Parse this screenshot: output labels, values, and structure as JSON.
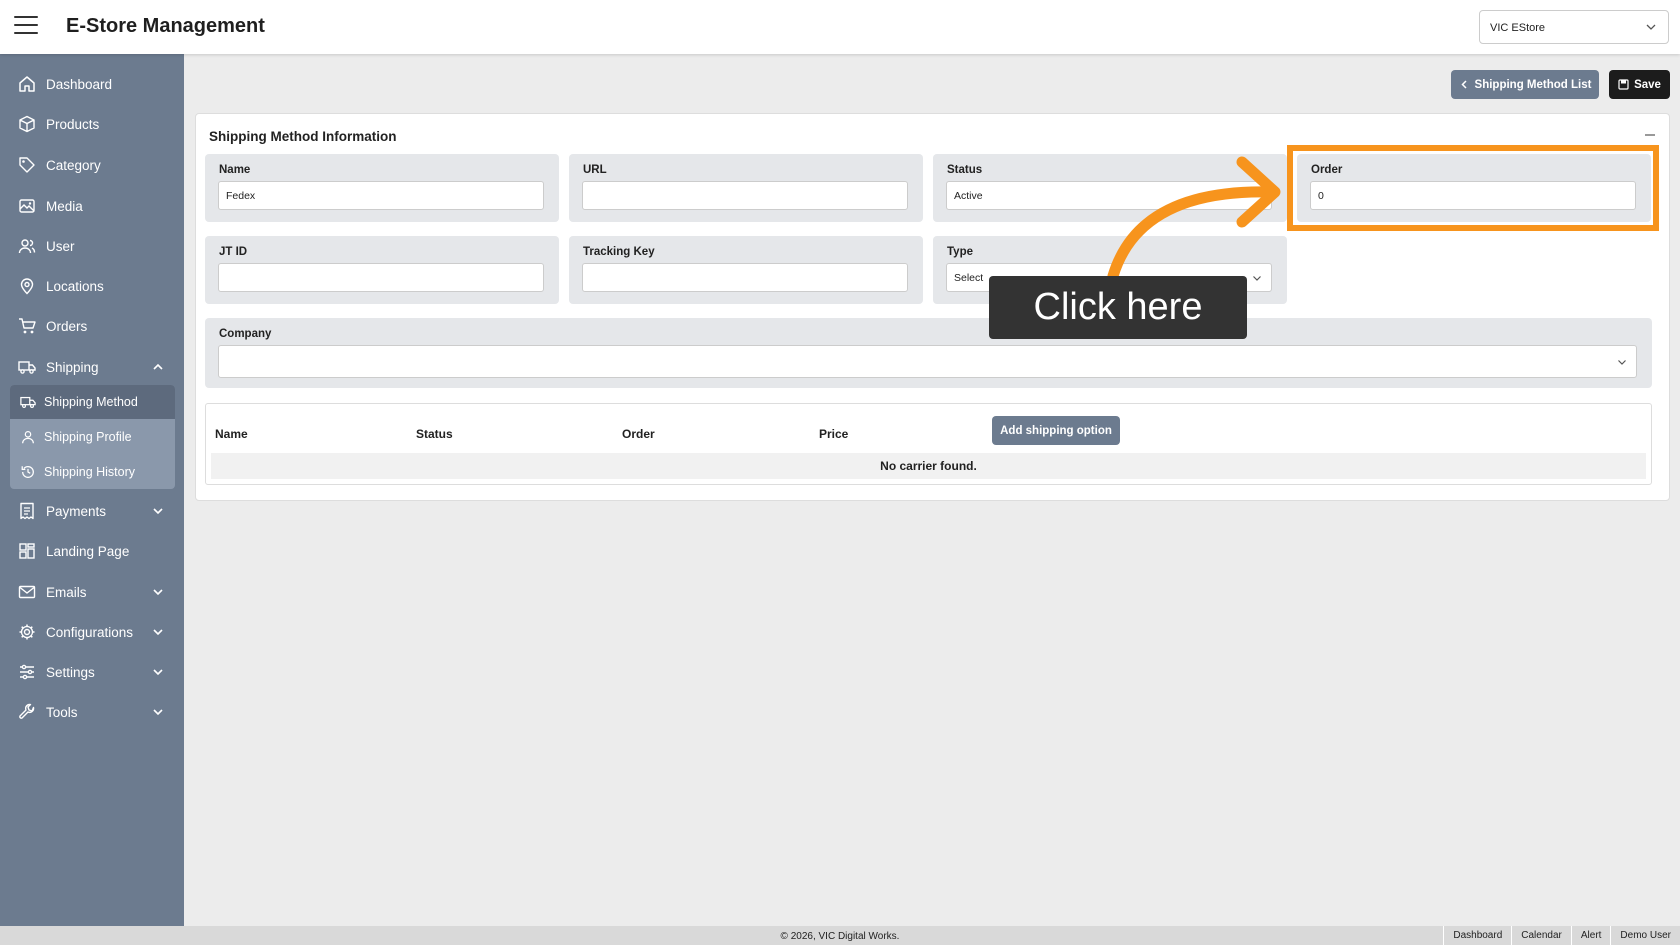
{
  "header": {
    "title": "E-Store Management",
    "store_selected": "VIC EStore"
  },
  "sidebar": {
    "items": [
      {
        "label": "Dashboard",
        "icon": "home-icon"
      },
      {
        "label": "Products",
        "icon": "box-icon"
      },
      {
        "label": "Category",
        "icon": "tag-icon"
      },
      {
        "label": "Media",
        "icon": "image-icon"
      },
      {
        "label": "User",
        "icon": "users-icon"
      },
      {
        "label": "Locations",
        "icon": "map-pin-icon"
      },
      {
        "label": "Orders",
        "icon": "cart-icon"
      },
      {
        "label": "Shipping",
        "icon": "truck-icon"
      },
      {
        "label": "Payments",
        "icon": "receipt-icon"
      },
      {
        "label": "Landing Page",
        "icon": "layout-icon"
      },
      {
        "label": "Emails",
        "icon": "mail-icon"
      },
      {
        "label": "Configurations",
        "icon": "cog-icon"
      },
      {
        "label": "Settings",
        "icon": "sliders-icon"
      },
      {
        "label": "Tools",
        "icon": "wrench-icon"
      }
    ],
    "shipping_sub": [
      {
        "label": "Shipping Method",
        "icon": "truck-icon"
      },
      {
        "label": "Shipping Profile",
        "icon": "person-icon"
      },
      {
        "label": "Shipping History",
        "icon": "history-icon"
      }
    ]
  },
  "toolbar": {
    "list_label": "Shipping Method List",
    "save_label": "Save"
  },
  "card": {
    "title": "Shipping Method Information"
  },
  "form": {
    "name": {
      "label": "Name",
      "value": "Fedex"
    },
    "url": {
      "label": "URL",
      "value": ""
    },
    "status": {
      "label": "Status",
      "value": "Active"
    },
    "order": {
      "label": "Order",
      "value": "0"
    },
    "jt_id": {
      "label": "JT ID",
      "value": ""
    },
    "tracking_key": {
      "label": "Tracking Key",
      "value": ""
    },
    "type": {
      "label": "Type",
      "value": "Select"
    },
    "company": {
      "label": "Company",
      "value": ""
    }
  },
  "table": {
    "columns": [
      "Name",
      "Status",
      "Order",
      "Price"
    ],
    "add_label": "Add shipping option",
    "empty_text": "No carrier found."
  },
  "annotation": {
    "callout_text": "Click here",
    "highlight_color": "#f7941d"
  },
  "footer": {
    "copyright": "© 2026, VIC Digital Works.",
    "links": [
      "Dashboard",
      "Calendar",
      "Alert",
      "Demo User"
    ]
  },
  "colors": {
    "sidebar": "#6c7b8f",
    "submenu": "#8a98ab",
    "save_button": "#1c1c1c"
  }
}
